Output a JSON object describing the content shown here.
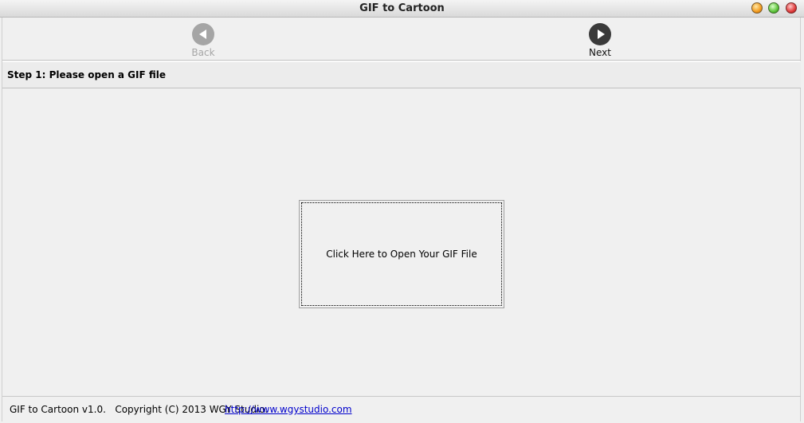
{
  "window": {
    "title": "GIF to Cartoon"
  },
  "toolbar": {
    "back_label": "Back",
    "next_label": "Next"
  },
  "step": {
    "text": "Step 1: Please open a GIF file"
  },
  "main": {
    "open_label": "Click Here to Open Your GIF File"
  },
  "status": {
    "text": "GIF to Cartoon v1.0.   Copyright (C) 2013 WGY Studio.",
    "link": "http://www.wgystudio.com"
  },
  "colors": {
    "back_disabled": "#a5a5a5",
    "next_enabled": "#3a3a3a",
    "link": "#0000cc"
  }
}
